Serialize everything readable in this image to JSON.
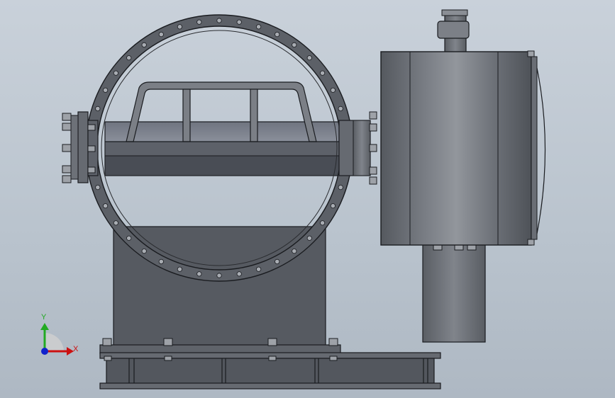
{
  "triad": {
    "y_label": "Y",
    "x_label": "X",
    "y_color": "#22aa22",
    "x_color": "#cc1111",
    "z_color": "#1122cc"
  },
  "colors": {
    "steel_dark": "#4a4e55",
    "steel_mid": "#6a6e75",
    "steel_light": "#8a8f96",
    "outline": "#1a1c20"
  }
}
